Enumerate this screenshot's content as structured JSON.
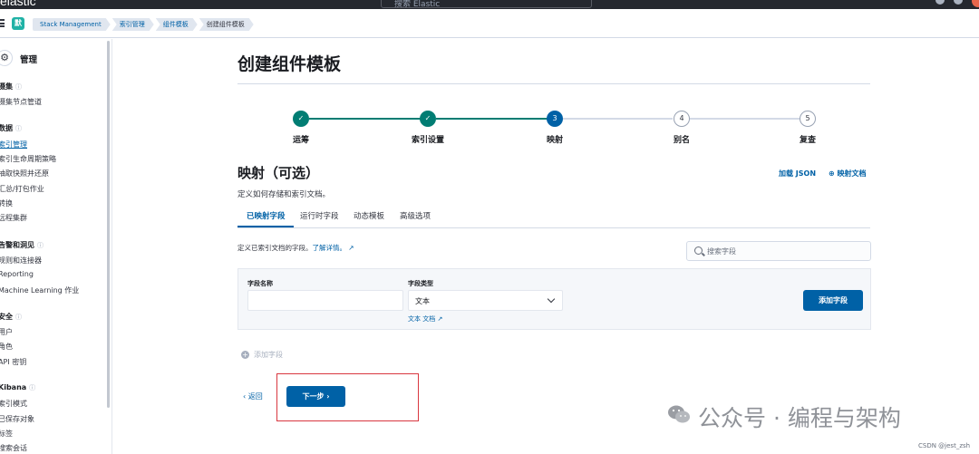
{
  "header": {
    "logo": "elastic",
    "search_placeholder": "搜索 Elastic",
    "space_badge": "默",
    "breadcrumbs": [
      "Stack Management",
      "索引管理",
      "组件模板",
      "创建组件模板"
    ]
  },
  "sidebar": {
    "title": "管理",
    "groups": [
      {
        "label": "摄集",
        "items": [
          "摄集节点管道"
        ]
      },
      {
        "label": "数据",
        "items": [
          "索引管理",
          "索引生命周期策略",
          "抽取快照并还原",
          "汇总/打包作业",
          "转换",
          "远程集群"
        ]
      },
      {
        "label": "告警和洞见",
        "items": [
          "规则和连接器",
          "Reporting",
          "Machine Learning 作业"
        ]
      },
      {
        "label": "安全",
        "items": [
          "用户",
          "角色",
          "API 密钥"
        ]
      },
      {
        "label": "Kibana",
        "items": [
          "索引模式",
          "已保存对象",
          "标签",
          "搜索会话"
        ]
      }
    ]
  },
  "main": {
    "title": "创建组件模板",
    "steps": [
      {
        "label": "运筹",
        "status": "done",
        "number": "1"
      },
      {
        "label": "索引设置",
        "status": "done",
        "number": "2"
      },
      {
        "label": "映射",
        "status": "current",
        "number": "3"
      },
      {
        "label": "别名",
        "status": "todo",
        "number": "4"
      },
      {
        "label": "复查",
        "status": "todo",
        "number": "5"
      }
    ],
    "section_title": "映射（可选）",
    "section_desc": "定义如何存储和索引文档。",
    "load_json": "加载 JSON",
    "mapping_doc": "映射文档",
    "tabs": [
      "已映射字段",
      "运行时字段",
      "动态模板",
      "高级选项"
    ],
    "help_text": "定义已索引文档的字段。",
    "help_link": "了解详情。",
    "search_field_placeholder": "搜索字段",
    "field_name_label": "字段名称",
    "field_type_label": "字段类型",
    "field_type_value": "文本",
    "field_type_doc": "文本 文档",
    "add_field_button": "添加字段",
    "add_field_disabled": "添加字段",
    "back": "返回",
    "next": "下一步"
  },
  "overlay": {
    "watermark": "公众号 · 编程与架构",
    "credit": "CSDN @jest_zsh"
  },
  "colors": {
    "primary": "#0061a6",
    "success": "#017d73",
    "highlight_border": "#d9373f"
  }
}
